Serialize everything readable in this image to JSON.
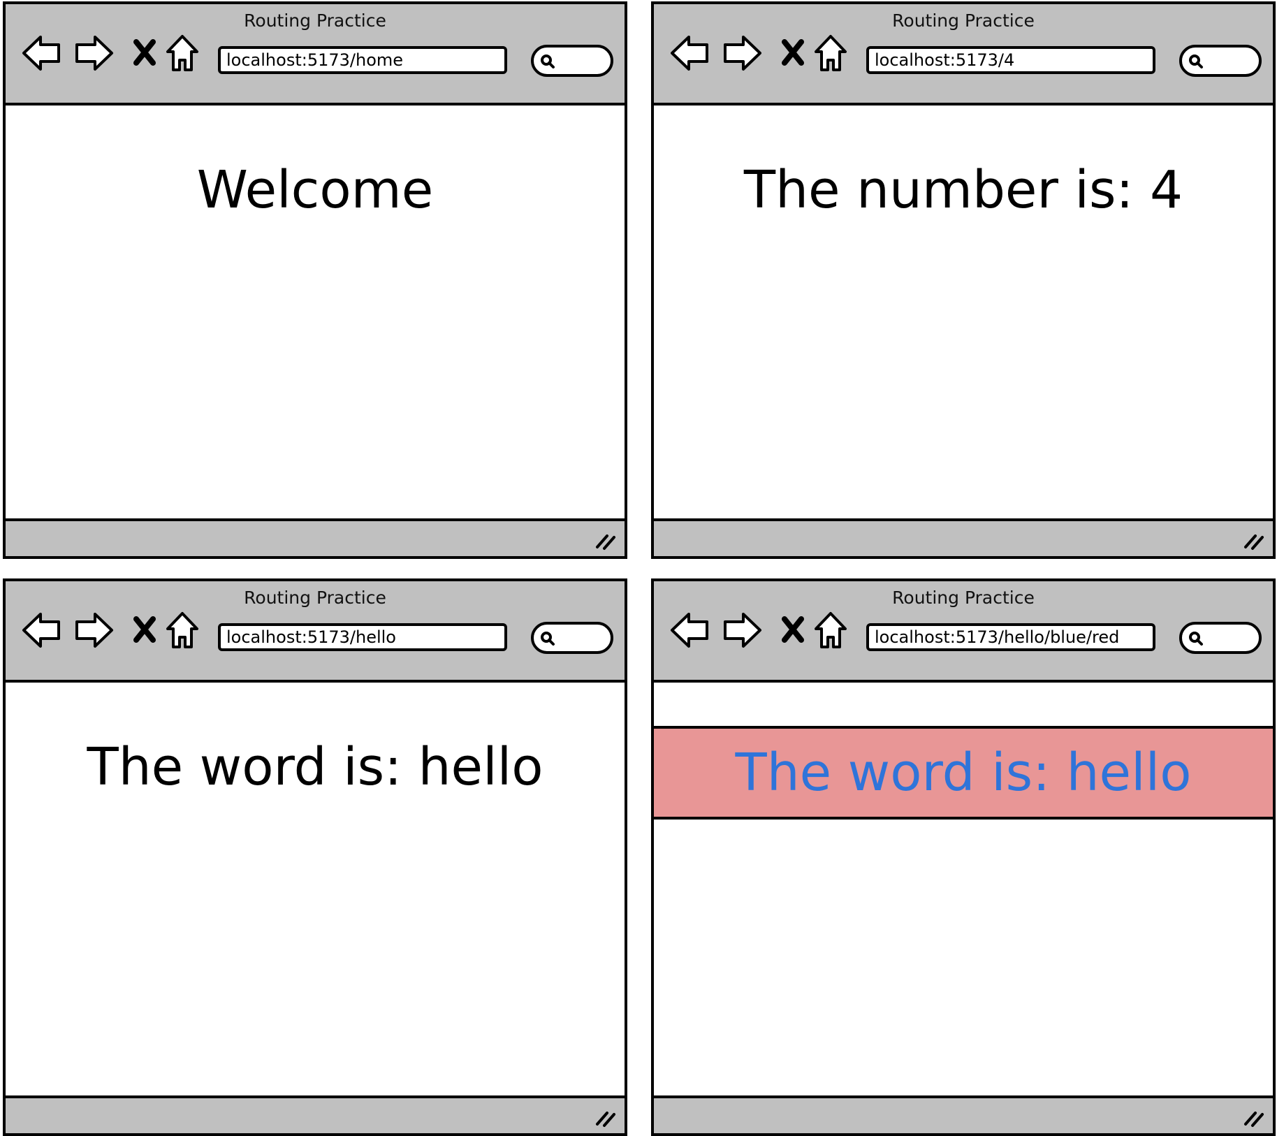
{
  "windows": [
    {
      "title": "Routing Practice",
      "url": "localhost:5173/home",
      "heading": "Welcome"
    },
    {
      "title": "Routing Practice",
      "url": "localhost:5173/4",
      "heading": "The number is: 4"
    },
    {
      "title": "Routing Practice",
      "url": "localhost:5173/hello",
      "heading": "The word is: hello"
    },
    {
      "title": "Routing Practice",
      "url": "localhost:5173/hello/blue/red",
      "heading": "The word is: hello",
      "text_color": "#2f74d9",
      "background_color": "#e89696"
    }
  ],
  "icons": {
    "back": "arrow-left-icon",
    "forward": "arrow-right-icon",
    "stop": "close-icon",
    "home": "home-icon",
    "search": "search-icon",
    "resize": "resize-grip-icon"
  },
  "colors": {
    "chrome_gray": "#c0c0c0",
    "outline": "#000000",
    "page_background": "#ffffff"
  }
}
